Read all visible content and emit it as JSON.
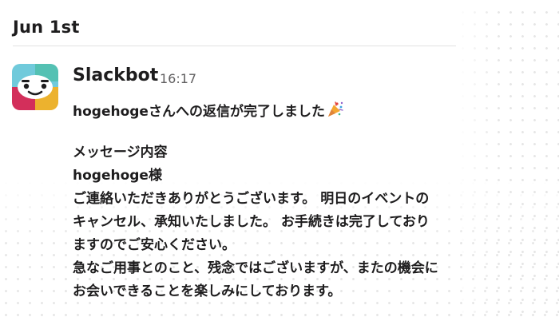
{
  "date_header": "Jun 1st",
  "message": {
    "sender": "Slackbot",
    "timestamp": "16:17",
    "title": "hogehogeさんへの返信が完了しました",
    "title_emoji": "party-popper-icon",
    "body_lines": [
      "メッセージ内容",
      "hogehoge様",
      "ご連絡いただきありがとうございます。 明日のイベントの",
      "キャンセル、承知いたしました。 お手続きは完了しており",
      "ますのでご安心ください。",
      "急なご用事とのこと、残念ではございますが、またの機会に",
      "お会いできることを楽しみにしております。"
    ]
  },
  "colors": {
    "text": "#1d1c1d",
    "timestamp": "#616061",
    "avatar_blue": "#70cadb",
    "avatar_red": "#d32f5b",
    "avatar_yellow": "#ecb22e",
    "avatar_green": "#3eb991"
  }
}
